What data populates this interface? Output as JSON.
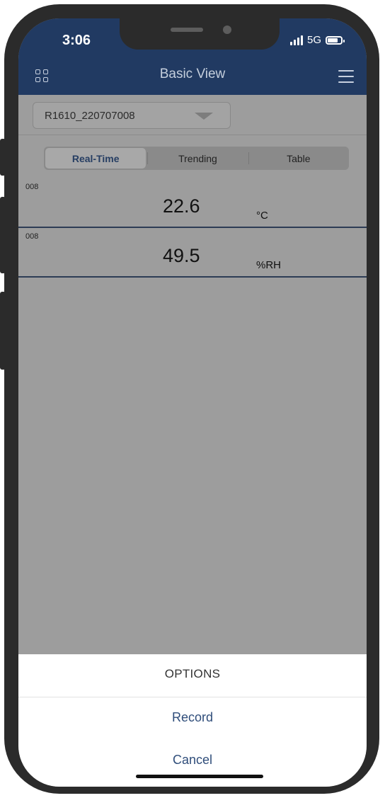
{
  "status_bar": {
    "time": "3:06",
    "network": "5G"
  },
  "header": {
    "title": "Basic View",
    "left_icon": "grid-icon",
    "right_icon": "menu-icon"
  },
  "device_selector": {
    "value": "R1610_220707008"
  },
  "tabs": [
    {
      "label": "Real-Time",
      "active": true
    },
    {
      "label": "Trending",
      "active": false
    },
    {
      "label": "Table",
      "active": false
    }
  ],
  "readings": [
    {
      "label": "008",
      "value": "22.6",
      "unit": "°C"
    },
    {
      "label": "008",
      "value": "49.5",
      "unit": "%RH"
    }
  ],
  "action_sheet": {
    "title": "OPTIONS",
    "options": [
      "Record",
      "Cancel"
    ]
  },
  "colors": {
    "header": "#213a62",
    "accent": "#2f4d7a",
    "overlay": "#9d9d9d"
  }
}
